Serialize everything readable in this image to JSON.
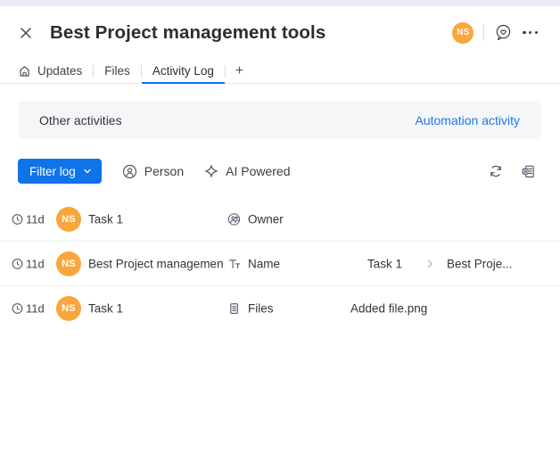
{
  "header": {
    "title": "Best Project management tools",
    "avatar_initials": "NS"
  },
  "tabs": [
    {
      "label": "Updates",
      "active": false
    },
    {
      "label": "Files",
      "active": false
    },
    {
      "label": "Activity Log",
      "active": true
    },
    {
      "label": "+",
      "active": false
    }
  ],
  "banner": {
    "title": "Other activities",
    "link": "Automation activity"
  },
  "toolbar": {
    "filter_label": "Filter log",
    "person_label": "Person",
    "ai_label": "AI Powered"
  },
  "rows": [
    {
      "time": "11d",
      "avatar_initials": "NS",
      "item": "Task 1",
      "column": "Owner"
    },
    {
      "time": "11d",
      "avatar_initials": "NS",
      "item": "Best Project managemen...",
      "column": "Name",
      "old_value": "Task 1",
      "new_value": "Best Proje..."
    },
    {
      "time": "11d",
      "avatar_initials": "NS",
      "item": "Task 1",
      "column": "Files",
      "value": "Added file.png"
    }
  ],
  "icons": {
    "close": "x-cross",
    "home": "house-outline",
    "feedback": "chat-bubble-heart",
    "more": "ellipsis-horizontal",
    "filter_chevron": "chevron-down",
    "person": "person-in-circle",
    "ai": "four-point-sparkle",
    "refresh": "circular-arrows",
    "export": "excel-sheet",
    "time": "clock",
    "owner_column": "people-in-circle",
    "name_column": "double-T-text",
    "files_column": "document-lines",
    "value_arrow": "chevron-right"
  },
  "colors": {
    "accent": "#0f73ea",
    "link": "#1f76f2",
    "avatar": "#f9a63c",
    "banner_bg": "#f5f6f8"
  }
}
